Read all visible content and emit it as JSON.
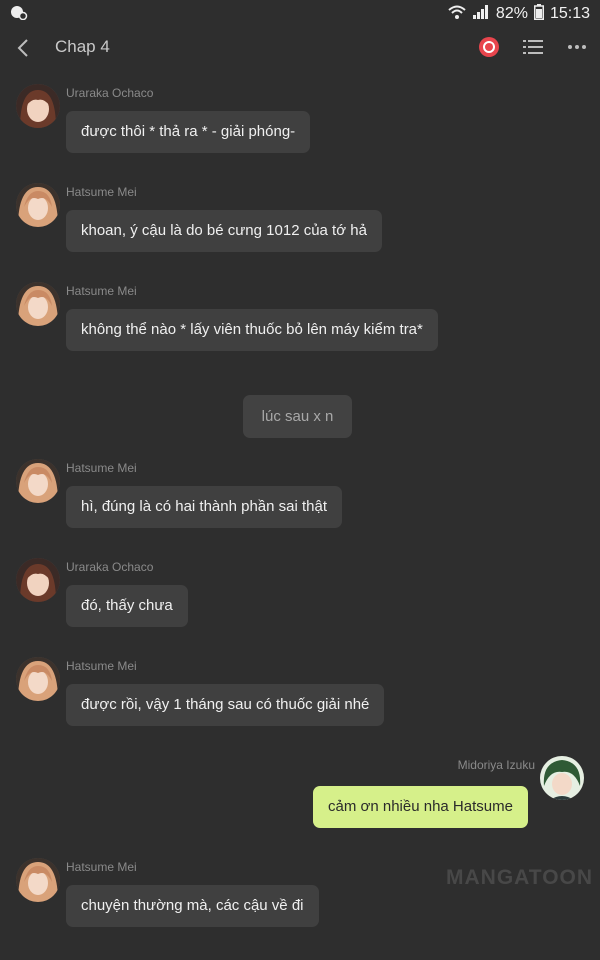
{
  "status_bar": {
    "battery": "82%",
    "time": "15:13"
  },
  "header": {
    "title": "Chap 4"
  },
  "system_message": "lúc sau x n",
  "messages": [
    {
      "sender": "Uraraka Ochaco",
      "text": "được thôi * thả ra * - giải phóng-"
    },
    {
      "sender": "Hatsume Mei",
      "text": "khoan, ý cậu là do bé cưng 1012 của tớ hả"
    },
    {
      "sender": "Hatsume Mei",
      "text": "không thể nào * lấy viên thuốc bỏ lên máy kiểm tra*"
    },
    {
      "sender": "Hatsume Mei",
      "text": "hì, đúng là có hai thành phần sai thật"
    },
    {
      "sender": "Uraraka Ochaco",
      "text": "đó, thấy chưa"
    },
    {
      "sender": "Hatsume Mei",
      "text": "được rồi, vậy 1 tháng sau có thuốc giải nhé"
    },
    {
      "sender": "Midoriya Izuku",
      "text": "cảm ơn nhiều nha Hatsume"
    },
    {
      "sender": "Hatsume Mei",
      "text": "chuyện thường mà, các cậu về đi"
    }
  ],
  "watermark": "MANGATOON",
  "colors": {
    "background": "#2e2e2e",
    "bubble": "#404040",
    "my_bubble": "#d6f08a",
    "accent": "#e8454d"
  }
}
